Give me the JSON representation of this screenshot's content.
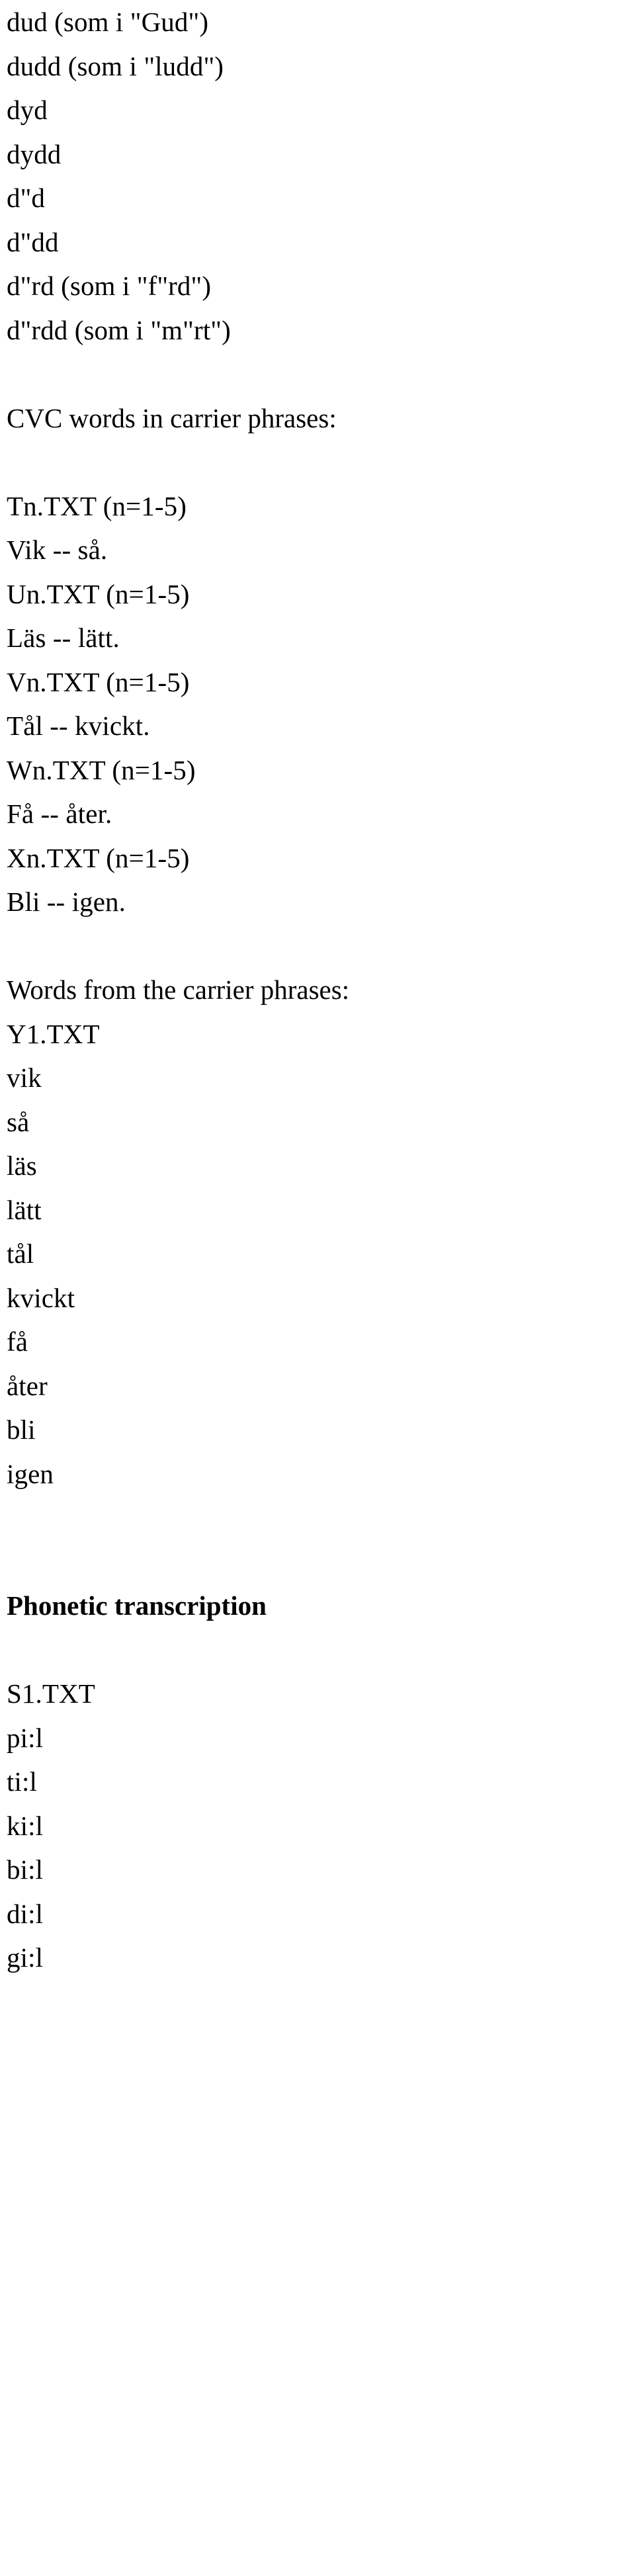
{
  "document": {
    "nonsense_words": [
      "dud (som i \"Gud\")",
      "dudd (som i \"ludd\")",
      "dyd",
      "dydd",
      "d\"d",
      "d\"dd",
      "d\"rd (som i \"f\"rd\")",
      "d\"rdd (som i \"m\"rt\")"
    ],
    "cvc_section": {
      "heading": "CVC words in carrier phrases:",
      "entries": [
        {
          "file": "Tn.TXT (n=1-5)",
          "phrase": "Vik -- så."
        },
        {
          "file": "Un.TXT (n=1-5)",
          "phrase": "Läs -- lätt."
        },
        {
          "file": "Vn.TXT (n=1-5)",
          "phrase": "Tål -- kvickt."
        },
        {
          "file": "Wn.TXT (n=1-5)",
          "phrase": "Få -- åter."
        },
        {
          "file": "Xn.TXT (n=1-5)",
          "phrase": "Bli -- igen."
        }
      ]
    },
    "words_section": {
      "heading": "Words from the carrier phrases:",
      "file": "Y1.TXT",
      "words": [
        "vik",
        "så",
        "läs",
        "lätt",
        "tål",
        "kvickt",
        "få",
        "åter",
        "bli",
        "igen"
      ]
    },
    "phonetic_section": {
      "heading": "Phonetic transcription",
      "file": "S1.TXT",
      "transcriptions": [
        "pi:l",
        "ti:l",
        "ki:l",
        "bi:l",
        "di:l",
        "gi:l"
      ]
    }
  }
}
